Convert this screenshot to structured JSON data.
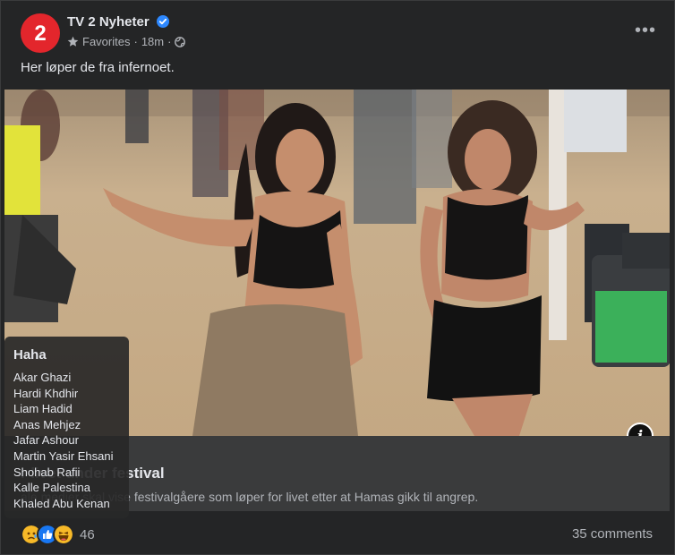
{
  "post": {
    "page_name": "TV 2 Nyheter",
    "audience": "Favorites",
    "separator": "·",
    "time": "18m",
    "caption": "Her løper de fra infernoet.",
    "more_label": "•••",
    "avatar_text": "2"
  },
  "link": {
    "title": "r livet under festival",
    "description": "ale medier skal vise festivalgåere som løper for livet etter at Hamas gikk til angrep."
  },
  "tooltip": {
    "title": "Haha",
    "names": [
      "Akar Ghazi",
      "Hardi Khdhir",
      "Liam Hadid",
      "Anas Mehjez",
      "Jafar Ashour",
      "Martin Yasir Ehsani",
      "Shohab Rafii",
      "Kalle Palestina",
      "Khaled Abu Kenan"
    ]
  },
  "footer": {
    "reaction_icons": [
      "sad-icon",
      "like-icon",
      "haha-icon"
    ],
    "reaction_count": "46",
    "comments": "35 comments"
  },
  "colors": {
    "brand": "#e3262c",
    "verified": "#2d88ff",
    "background": "#242526",
    "like": "#1877f2",
    "reaction_yellow": "#f7b928"
  }
}
